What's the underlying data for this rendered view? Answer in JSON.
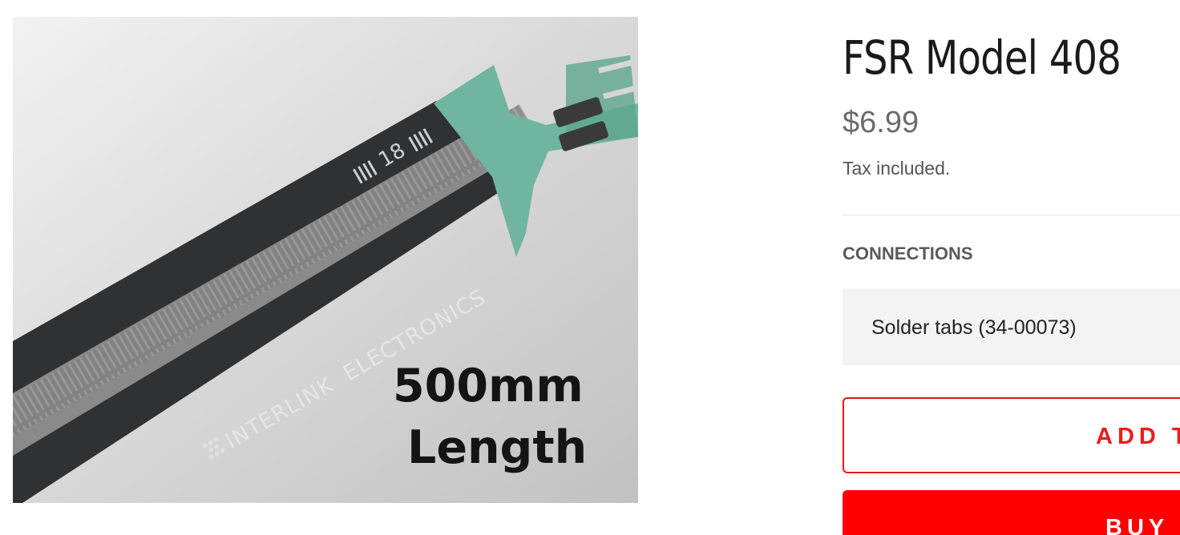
{
  "product": {
    "title": "FSR Model 408",
    "price": "$6.99",
    "tax_note": "Tax included.",
    "image": {
      "alt": "Interlink Electronics FSR 408 sensor strip",
      "printed_brand": "INTERLINK  ELECTRONICS",
      "printed_mark": "18",
      "overlay_length": "500mm",
      "overlay_caption": "Length"
    }
  },
  "options": {
    "label": "CONNECTIONS",
    "selected": "Solder tabs (34-00073)"
  },
  "actions": {
    "add_to_cart_label": "ADD T",
    "buy_now_label": "BUY I"
  },
  "colors": {
    "accent": "#ee1c1c",
    "buy_button_bg": "#ff0000",
    "select_bg": "#f3f3f3",
    "price": "#6b6b6b"
  },
  "icons": [
    "interlink-logo-icon"
  ]
}
